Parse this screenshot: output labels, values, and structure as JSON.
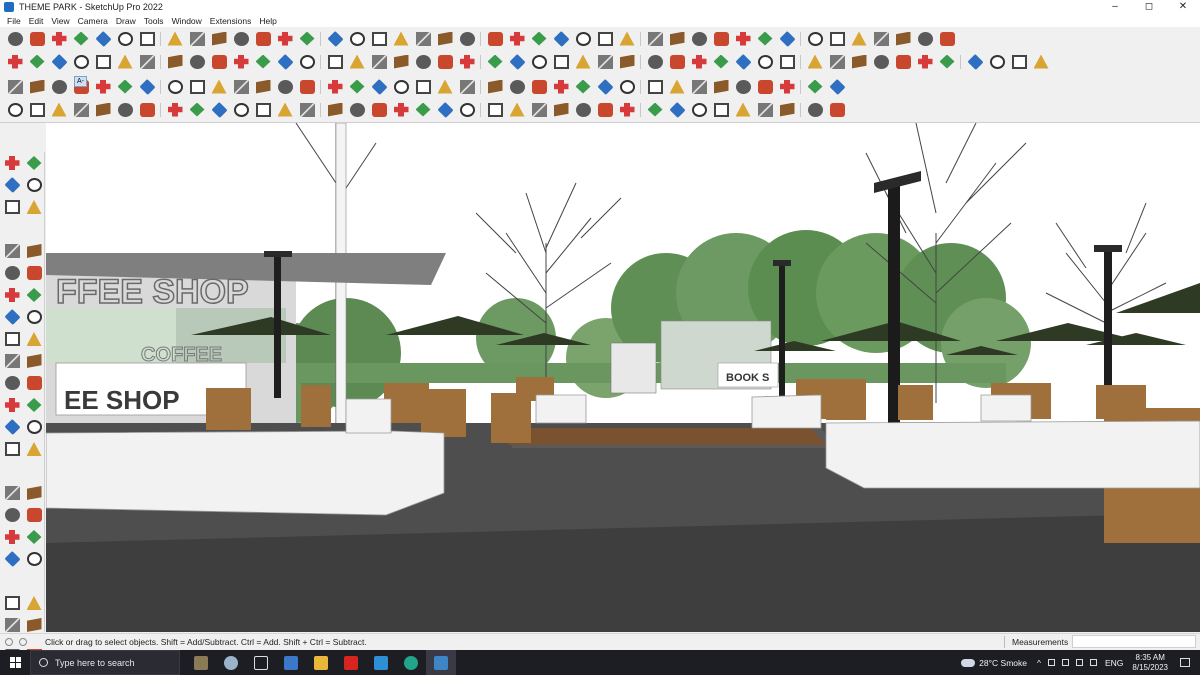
{
  "window": {
    "title": "THEME PARK - SketchUp Pro 2022",
    "controls": {
      "minimize": "–",
      "maximize": "◻",
      "close": "✕"
    }
  },
  "menu": {
    "items": [
      "File",
      "Edit",
      "View",
      "Camera",
      "Draw",
      "Tools",
      "Window",
      "Extensions",
      "Help"
    ]
  },
  "toolbar": {
    "overlay_label": "A-"
  },
  "viewport": {
    "scene_name": "theme-park-plaza",
    "signs": {
      "left_upper": "FFEE SHOP",
      "left_lower": "EE SHOP",
      "left_window": "COFFEE",
      "right": "BOOK S"
    },
    "colors": {
      "sky": "#ffffff",
      "foliage": "#5f8f55",
      "paving": "#4e4e4e",
      "deck": "#7a5230",
      "furniture": "#a0703c",
      "umbrella": "#2f3a25",
      "planter": "#f2f2f2"
    }
  },
  "status": {
    "hint": "Click or drag to select objects. Shift = Add/Subtract. Ctrl = Add. Shift + Ctrl = Subtract.",
    "measurements_label": "Measurements",
    "measurements_value": ""
  },
  "taskbar": {
    "search_placeholder": "Type here to search",
    "weather": "28°C  Smoke",
    "language": "ENG",
    "time": "8:35 AM",
    "date": "8/15/2023"
  }
}
